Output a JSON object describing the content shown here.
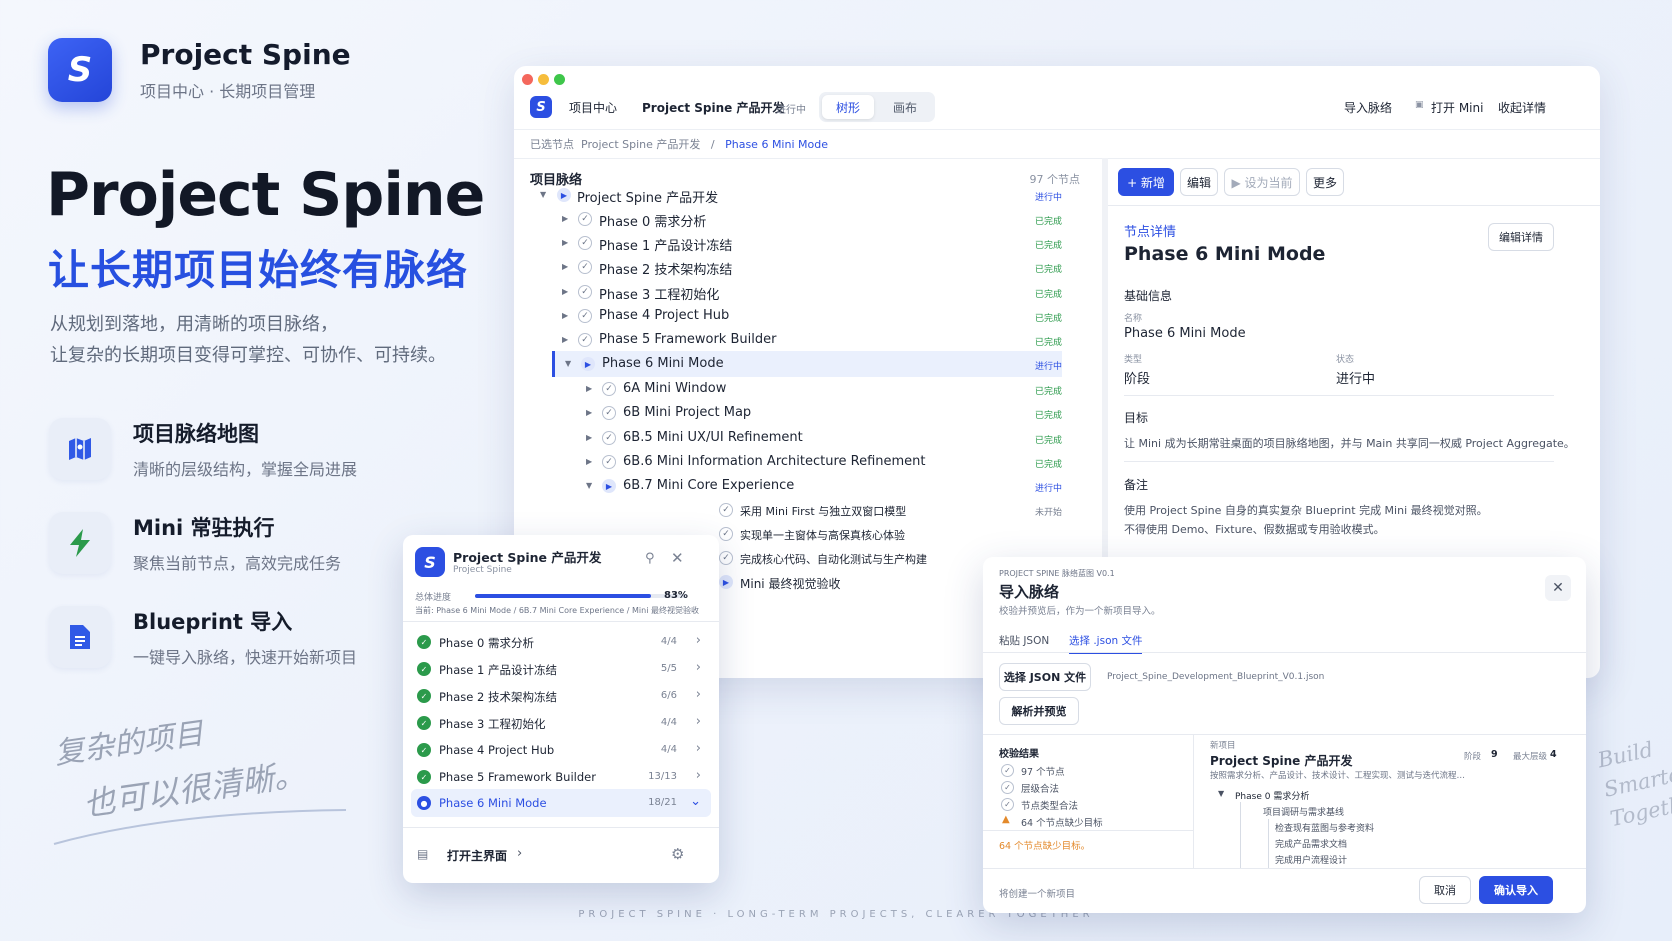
{
  "brand": {
    "name": "Project Spine",
    "subtitle": "项目中心 · 长期项目管理",
    "logo_letter": "S",
    "accent": "#2c4fe2"
  },
  "hero": {
    "title": "Project Spine",
    "tagline": "让长期项目始终有脉络",
    "desc_line1": "从规划到落地，用清晰的项目脉络，",
    "desc_line2": "让复杂的长期项目变得可掌控、可协作、可持续。"
  },
  "features": [
    {
      "icon": "map-icon",
      "title": "项目脉络地图",
      "desc": "清晰的层级结构，掌握全局进展"
    },
    {
      "icon": "lightning-icon",
      "title": "Mini 常驻执行",
      "desc": "聚焦当前节点，高效完成任务"
    },
    {
      "icon": "document-icon",
      "title": "Blueprint 导入",
      "desc": "一键导入脉络，快速开始新项目"
    }
  ],
  "slogan": {
    "line1": "复杂的项目",
    "line2": "也可以很清晰。"
  },
  "build_tag": {
    "line1": "Build",
    "line2": "Smarter",
    "line3": "Together"
  },
  "bottom_tag": "PROJECT SPINE · LONG-TERM PROJECTS, CLEARER TOGETHER",
  "main": {
    "topbar": {
      "home": "项目中心",
      "project": "Project Spine 产品开发",
      "status": "进行中",
      "seg_tree": "树形",
      "seg_canvas": "画布",
      "import": "导入脉络",
      "open_mini": "打开 Mini",
      "collapse": "收起详情"
    },
    "breadcrumb": {
      "prefix": "已选节点",
      "project": "Project Spine 产品开发",
      "sep": "/",
      "current": "Phase 6 Mini Mode"
    },
    "tree": {
      "title": "项目脉络",
      "count": "97 个节点",
      "rows": [
        {
          "label": "Project Spine 产品开发",
          "status": "进行中"
        },
        {
          "label": "Phase 0 需求分析",
          "status": "已完成"
        },
        {
          "label": "Phase 1 产品设计冻结",
          "status": "已完成"
        },
        {
          "label": "Phase 2 技术架构冻结",
          "status": "已完成"
        },
        {
          "label": "Phase 3 工程初始化",
          "status": "已完成"
        },
        {
          "label": "Phase 4 Project Hub",
          "status": "已完成"
        },
        {
          "label": "Phase 5 Framework Builder",
          "status": "已完成"
        },
        {
          "label": "Phase 6 Mini Mode",
          "status": "进行中"
        },
        {
          "label": "6A Mini Window",
          "status": "已完成"
        },
        {
          "label": "6B Mini Project Map",
          "status": "已完成"
        },
        {
          "label": "6B.5 Mini UX/UI Refinement",
          "status": "已完成"
        },
        {
          "label": "6B.6 Mini Information Architecture Refinement",
          "status": "已完成"
        },
        {
          "label": "6B.7 Mini Core Experience",
          "status": "进行中"
        },
        {
          "label": "采用 Mini First 与独立双窗口模型",
          "status": "未开始"
        },
        {
          "label": "实现单一主窗体与高保真核心体验",
          "status": ""
        },
        {
          "label": "完成核心代码、自动化测试与生产构建",
          "status": ""
        },
        {
          "label": "Mini 最终视觉验收",
          "status": ""
        }
      ]
    },
    "detail": {
      "add": "+ 新增",
      "edit": "编辑",
      "set_current": "▶ 设为当前",
      "more": "更多",
      "section": "节点详情",
      "title": "Phase 6 Mini Mode",
      "edit_detail": "编辑详情",
      "basic": "基础信息",
      "name_label": "名称",
      "name": "Phase 6 Mini Mode",
      "type_label": "类型",
      "type": "阶段",
      "state_label": "状态",
      "state": "进行中",
      "goal_label": "目标",
      "goal": "让 Mini 成为长期常驻桌面的项目脉络地图，并与 Main 共享同一权威 Project Aggregate。",
      "note_label": "备注",
      "note1": "使用 Project Spine 自身的真实复杂 Blueprint 完成 Mini 最终视觉对照。",
      "note2": "不得使用 Demo、Fixture、假数据或专用验收模式。"
    }
  },
  "mini": {
    "title": "Project Spine 产品开发",
    "subtitle": "Project Spine",
    "progress_label": "总体进度",
    "progress": 0.83,
    "progress_text": "83%",
    "current": "当前: Phase 6 Mini Mode / 6B.7 Mini Core Experience / Mini 最终视觉验收",
    "rows": [
      {
        "label": "Phase 0 需求分析",
        "count": "4/4"
      },
      {
        "label": "Phase 1 产品设计冻结",
        "count": "5/5"
      },
      {
        "label": "Phase 2 技术架构冻结",
        "count": "6/6"
      },
      {
        "label": "Phase 3 工程初始化",
        "count": "4/4"
      },
      {
        "label": "Phase 4 Project Hub",
        "count": "4/4"
      },
      {
        "label": "Phase 5 Framework Builder",
        "count": "13/13"
      },
      {
        "label": "Phase 6 Mini Mode",
        "count": "18/21"
      }
    ],
    "open_main": "打开主界面"
  },
  "dialog": {
    "kicker": "PROJECT SPINE 脉络蓝图 V0.1",
    "title": "导入脉络",
    "subtitle": "校验并预览后，作为一个新项目导入。",
    "tab_paste": "粘贴 JSON",
    "tab_file": "选择 .json 文件",
    "choose_btn": "选择 JSON 文件",
    "filename": "Project_Spine_Development_Blueprint_V0.1.json",
    "parse_btn": "解析并预览",
    "check_title": "校验结果",
    "checks": [
      "97 个节点",
      "层级合法",
      "节点类型合法",
      "64 个节点缺少目标"
    ],
    "warn": "64 个节点缺少目标。",
    "new_label": "新项目",
    "new_title": "Project Spine 产品开发",
    "stage_label": "阶段",
    "stage": "9",
    "depth_label": "最大层级",
    "depth": "4",
    "new_desc": "按照需求分析、产品设计、技术设计、工程实现、测试与迭代流程…",
    "preview": [
      "Phase 0 需求分析",
      "项目调研与需求基线",
      "检查现有蓝图与参考资料",
      "完成产品需求文档",
      "完成用户流程设计"
    ],
    "footer": "将创建一个新项目",
    "cancel": "取消",
    "confirm": "确认导入"
  }
}
